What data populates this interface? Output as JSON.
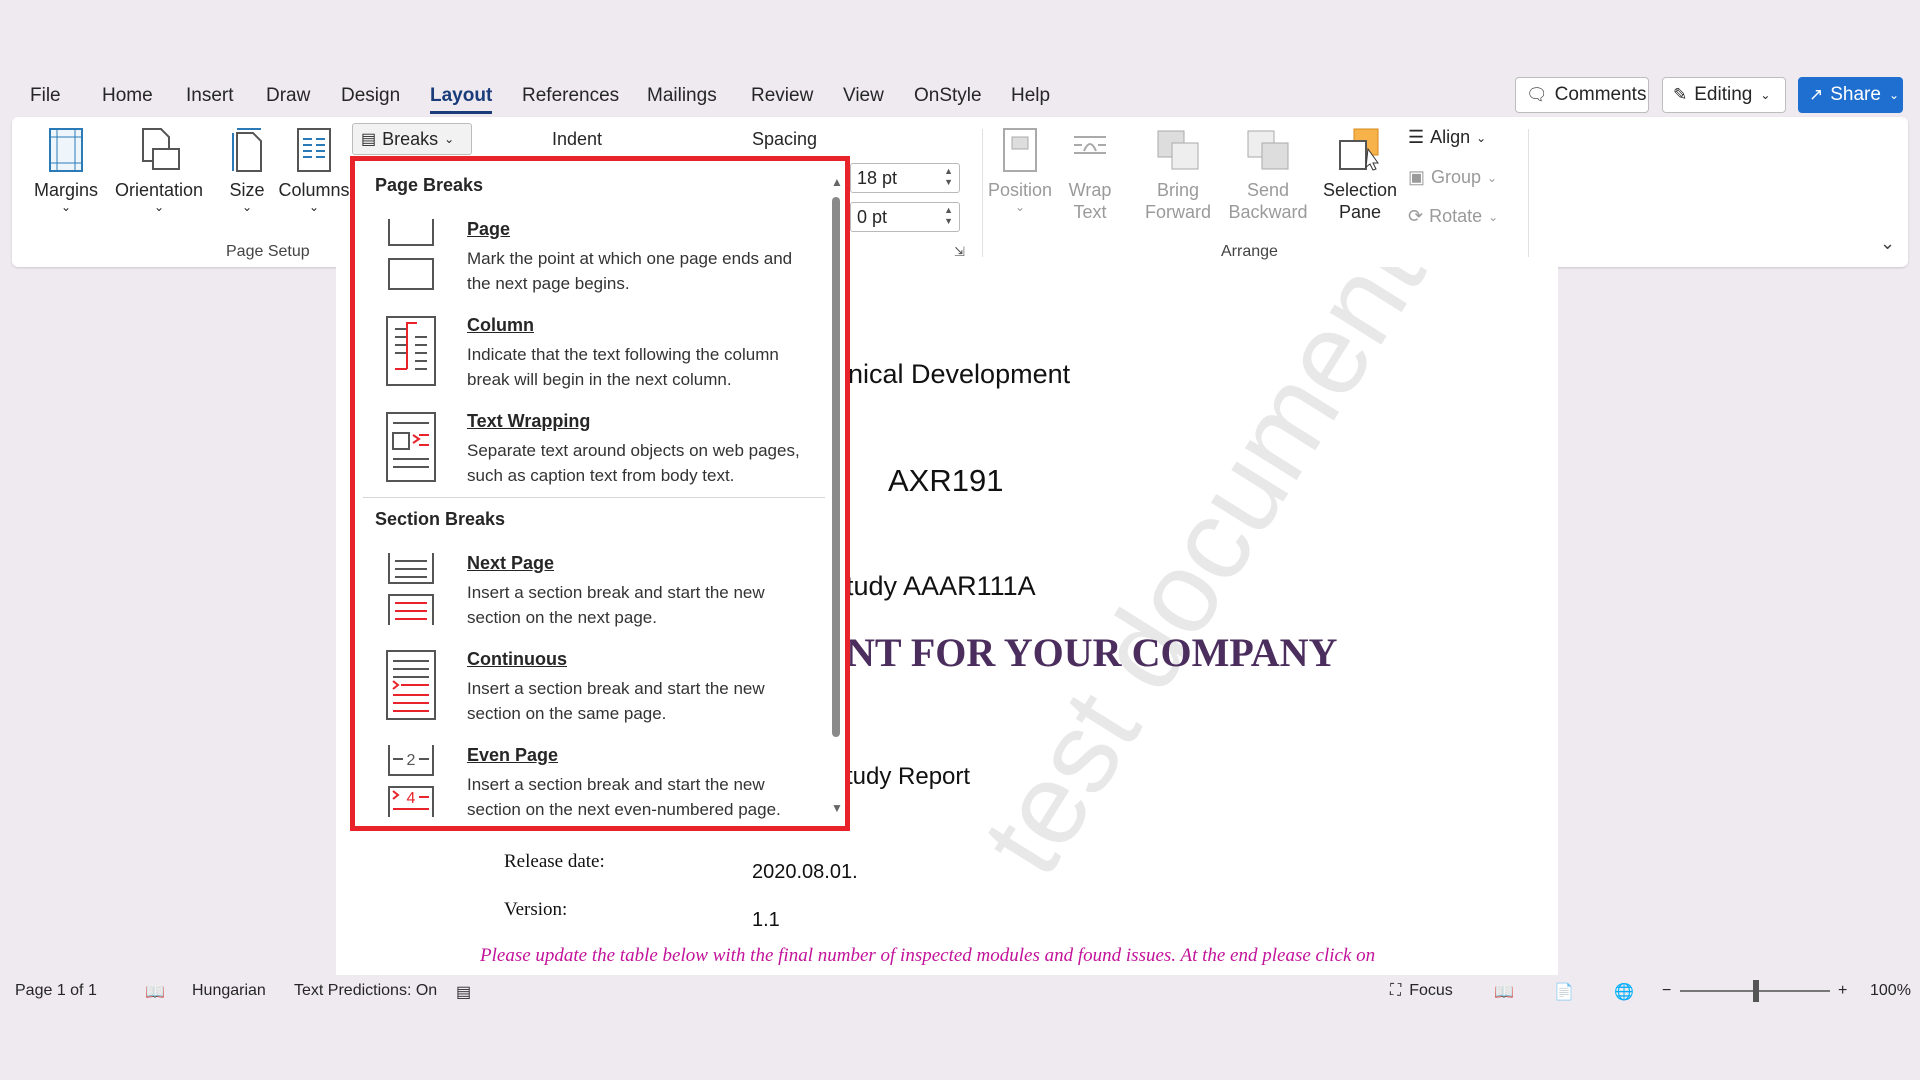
{
  "menu": {
    "items": [
      "File",
      "Home",
      "Insert",
      "Draw",
      "Design",
      "Layout",
      "References",
      "Mailings",
      "Review",
      "View",
      "OnStyle",
      "Help"
    ],
    "active": "Layout"
  },
  "top_buttons": {
    "comments": "Comments",
    "editing": "Editing",
    "share": "Share"
  },
  "ribbon": {
    "page_setup": {
      "margins": "Margins",
      "orientation": "Orientation",
      "size": "Size",
      "columns": "Columns",
      "breaks": "Breaks",
      "group_label": "Page Setup"
    },
    "paragraph": {
      "indent_label": "Indent",
      "spacing_label": "Spacing",
      "spacing_before": "18 pt",
      "spacing_after": "0 pt"
    },
    "arrange": {
      "position": "Position",
      "wrap": "Wrap",
      "wrap2": "Text",
      "bring": "Bring",
      "bring2": "Forward",
      "send": "Send",
      "send2": "Backward",
      "selection": "Selection",
      "selection2": "Pane",
      "align": "Align",
      "group": "Group",
      "rotate": "Rotate",
      "group_label": "Arrange"
    }
  },
  "document": {
    "line1": "nical Development",
    "line2": "AXR191",
    "line3": "tudy AAAR111A",
    "line4": "NT FOR YOUR COMPANY",
    "line5": "tudy Report",
    "release_partial": "Release",
    "release_label": "Release date:",
    "release_value": "2020.08.01.",
    "version_label": "Version:",
    "version_value": "1.1",
    "note": "Please update the table below with the final number of inspected modules and found issues. At the end please click on",
    "watermark": "test document"
  },
  "dropdown": {
    "page_breaks_header": "Page Breaks",
    "section_breaks_header": "Section Breaks",
    "items": [
      {
        "title": "Page",
        "desc": "Mark the point at which one page ends and the next page begins."
      },
      {
        "title": "Column",
        "desc": "Indicate that the text following the column break will begin in the next column."
      },
      {
        "title": "Text Wrapping",
        "desc": "Separate text around objects on web pages, such as caption text from body text."
      },
      {
        "title": "Next Page",
        "desc": "Insert a section break and start the new section on the next page."
      },
      {
        "title": "Continuous",
        "desc": "Insert a section break and start the new section on the same page."
      },
      {
        "title": "Even Page",
        "desc": "Insert a section break and start the new section on the next even-numbered page."
      }
    ],
    "even_icon_numbers": [
      "2",
      "4"
    ]
  },
  "status": {
    "page": "Page 1 of 1",
    "language": "Hungarian",
    "predictions": "Text Predictions: On",
    "focus": "Focus",
    "zoom": "100%"
  },
  "colors": {
    "accent": "#1f6fd0",
    "highlight_border": "#e8232a",
    "heading_purple": "#4b2d5e",
    "note_magenta": "#c2139a"
  }
}
